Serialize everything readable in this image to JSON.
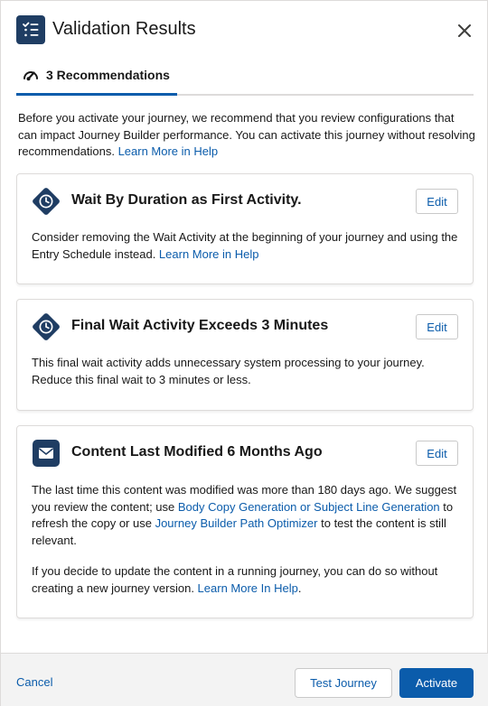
{
  "header": {
    "title": "Validation Results",
    "icon": "checklist-icon",
    "close_icon": "close-icon"
  },
  "tabs": [
    {
      "label": "3 Recommendations",
      "icon": "gauge-icon",
      "active": true
    }
  ],
  "intro": {
    "text": "Before you activate your journey, we recommend that you review configurations that can impact Journey Builder performance. You can activate this journey without resolving recommendations. ",
    "link": "Learn More in Help"
  },
  "cards": [
    {
      "title": "Wait By Duration as First Activity.",
      "icon": "clock-icon",
      "edit_label": "Edit",
      "body_text": "Consider removing the Wait Activity at the beginning of your journey and using the Entry Schedule instead. ",
      "body_link": "Learn More in Help"
    },
    {
      "title": "Final Wait Activity Exceeds 3 Minutes",
      "icon": "clock-icon",
      "edit_label": "Edit",
      "body_text": "This final wait activity adds unnecessary system processing to your journey. Reduce this final wait to 3 minutes or less."
    },
    {
      "title": "Content Last Modified 6 Months Ago",
      "icon": "email-icon",
      "edit_label": "Edit",
      "p1_a": "The last time this content was modified was more than 180 days ago. We suggest you review the content; use ",
      "p1_link1": "Body Copy Generation or Subject Line Generation",
      "p1_b": " to refresh the copy or use ",
      "p1_link2": "Journey Builder Path Optimizer",
      "p1_c": " to test the content is still relevant.",
      "p2_a": "If you decide to update the content in a running journey, you can do so without creating a new journey version. ",
      "p2_link": "Learn More In Help",
      "p2_b": "."
    }
  ],
  "footer": {
    "cancel_label": "Cancel",
    "test_label": "Test Journey",
    "activate_label": "Activate"
  },
  "colors": {
    "brand": "#0b5cab",
    "icon_navy": "#1f3d63",
    "text": "#181818",
    "border": "#dddbda",
    "footer_bg": "#f3f3f3"
  }
}
